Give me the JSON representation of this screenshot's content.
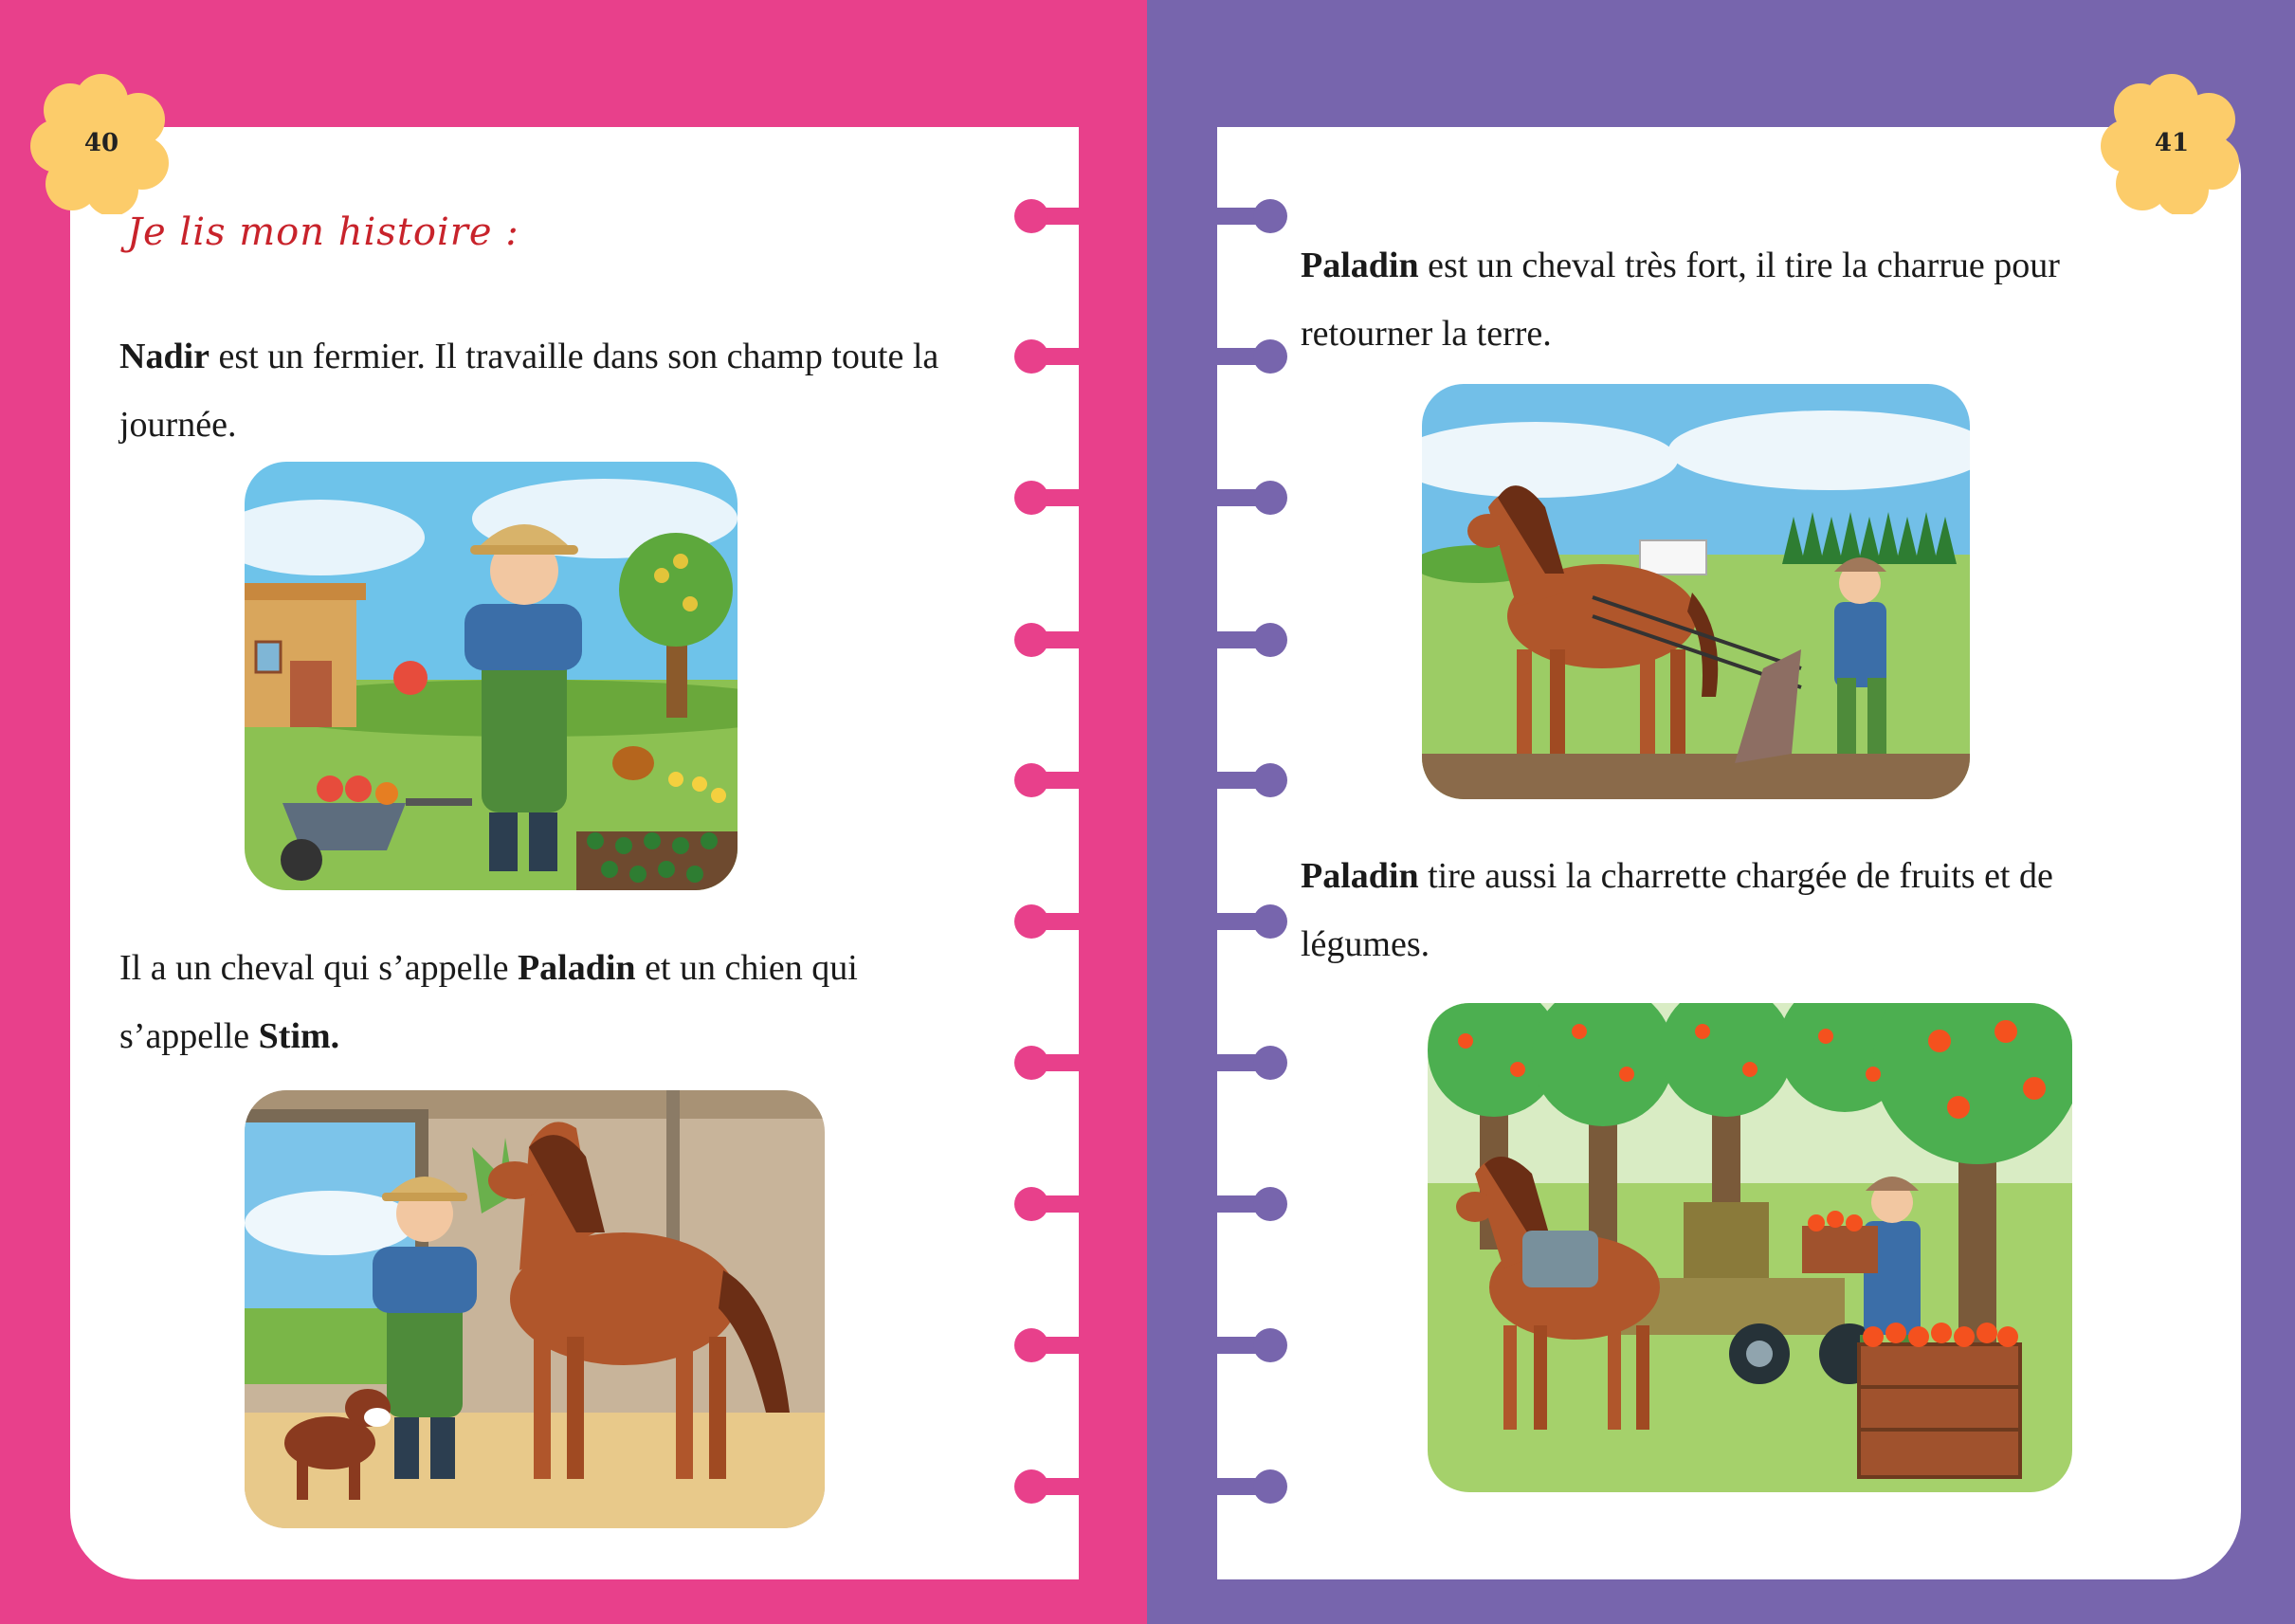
{
  "left_page": {
    "page_number": "40",
    "heading": "Je lis mon histoire :",
    "paragraph1": {
      "bold": "Nadir",
      "line1_rest": " est un fermier. Il travaille dans son champ toute la",
      "line2": "journée."
    },
    "paragraph2": {
      "line1_start": "Il a un cheval qui s’appelle ",
      "bold1": "Paladin",
      "line1_end": " et un chien qui",
      "line2_start": "s’appelle ",
      "bold2": "Stim."
    },
    "illustration1": {
      "icon": "farmer-with-wheelbarrow-illustration"
    },
    "illustration2": {
      "icon": "farmer-with-horse-and-dog-illustration"
    }
  },
  "right_page": {
    "page_number": "41",
    "paragraph1": {
      "bold": "Paladin",
      "line1_rest": " est un cheval très fort, il tire la charrue pour",
      "line2": "retourner la terre."
    },
    "paragraph2": {
      "bold": "Paladin",
      "line1_rest": " tire aussi la charrette chargée de fruits et de",
      "line2": "légumes."
    },
    "illustration1": {
      "icon": "horse-pulling-plough-illustration"
    },
    "illustration2": {
      "icon": "horse-with-cart-of-oranges-illustration"
    }
  },
  "colors": {
    "left_background": "#e8408b",
    "right_background": "#7765ad",
    "flower": "#fccc6a",
    "heading": "#c8232b"
  }
}
